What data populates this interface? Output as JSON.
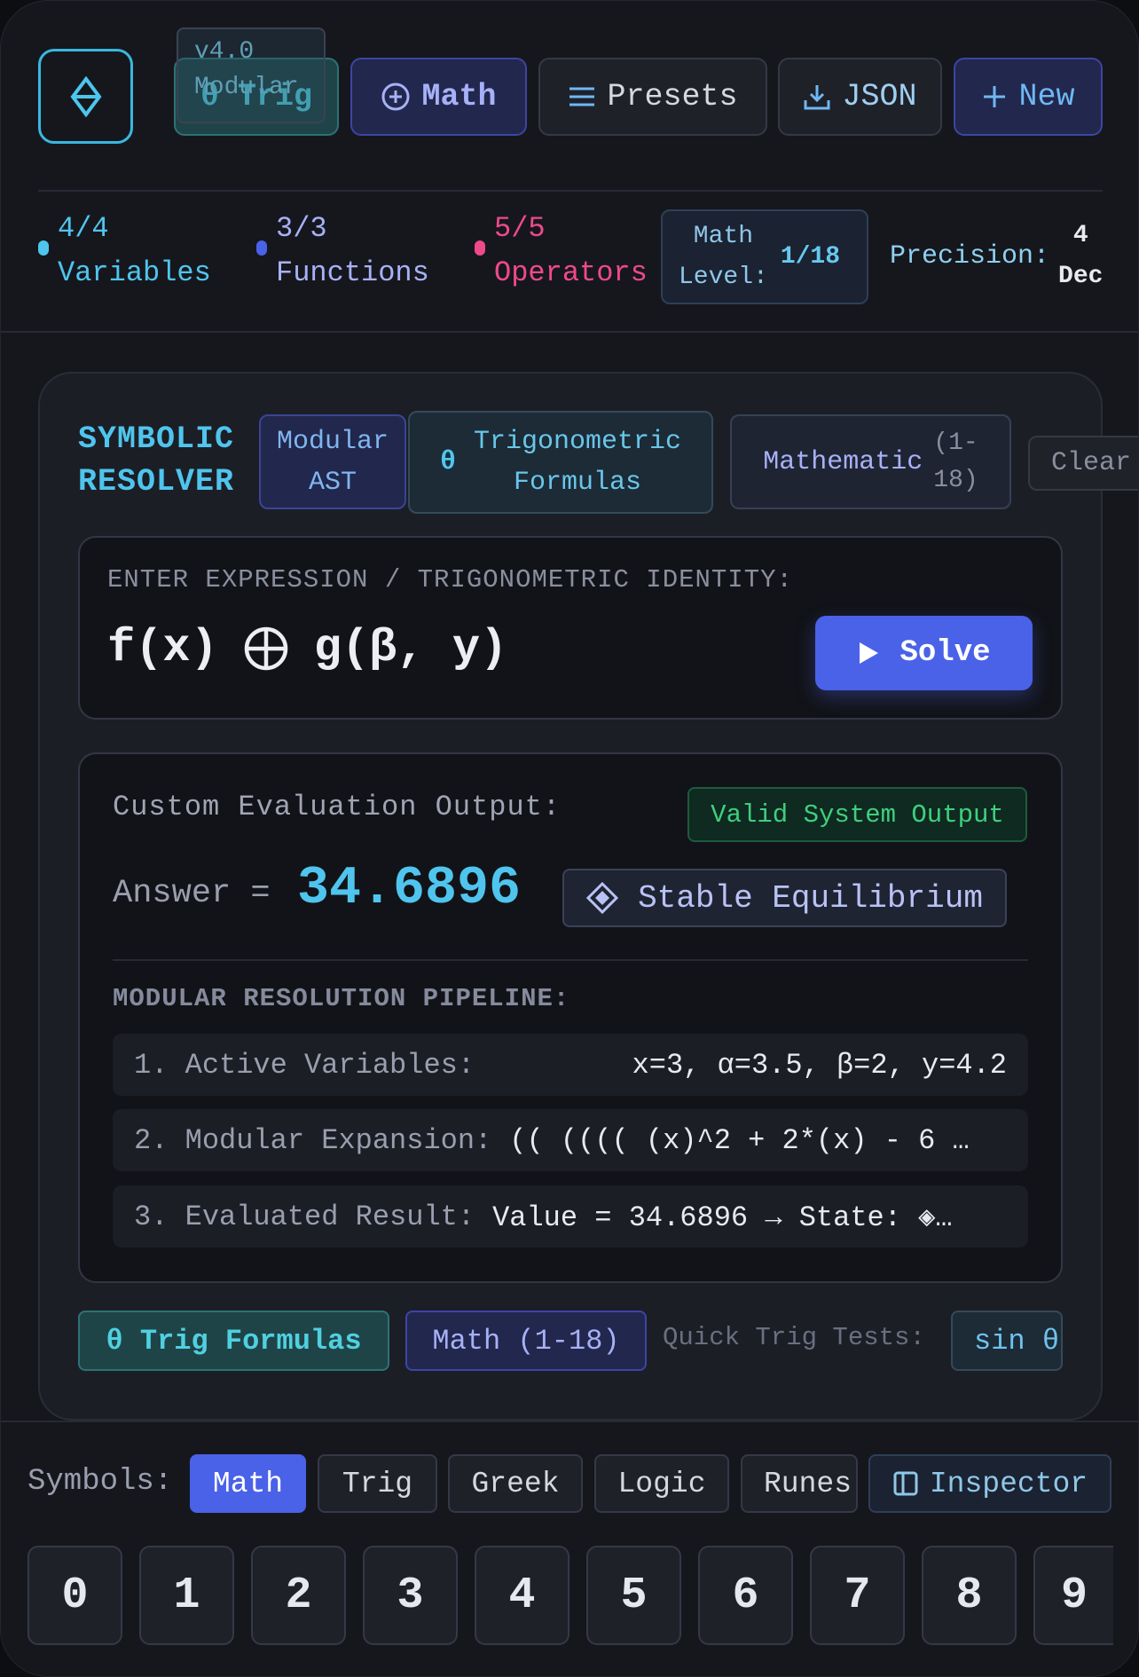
{
  "header": {
    "version": "v4.0",
    "version_sub": "Modular",
    "tabs": [
      {
        "icon": "theta-icon",
        "label": "θ Trig"
      },
      {
        "icon": "plus-circle-icon",
        "label": "Math"
      },
      {
        "icon": "menu-icon",
        "label": "Presets"
      },
      {
        "icon": "download-icon",
        "label": "JSON"
      },
      {
        "icon": "plus-icon",
        "label": "New"
      }
    ]
  },
  "stats": {
    "variables": {
      "count": "4/4",
      "label": "Variables",
      "color": "#4fc5ee"
    },
    "functions": {
      "count": "3/3",
      "label": "Functions",
      "color": "#4a62e8"
    },
    "operators": {
      "count": "5/5",
      "label": "Operators",
      "color": "#ee4a8a"
    },
    "level": {
      "label_line1": "Math",
      "label_line2": "Level:",
      "value": "1/18"
    },
    "precision": {
      "label": "Precision:",
      "value_line1": "4",
      "value_line2": "Dec"
    }
  },
  "resolver": {
    "title_line1": "SYMBOLIC",
    "title_line2": "RESOLVER",
    "chip_ast_line1": "Modular",
    "chip_ast_line2": "AST",
    "chip_trig_symbol": "θ",
    "chip_trig_line1": "Trigonometric",
    "chip_trig_line2": "Formulas",
    "chip_math": "Mathematic",
    "chip_math_range_line1": "(1-",
    "chip_math_range_line2": "18)",
    "chip_clear": "Clear"
  },
  "expression": {
    "label": "ENTER EXPRESSION / TRIGONOMETRIC IDENTITY:",
    "left": "f(x)",
    "right": "g(β, y)",
    "solve_label": "Solve"
  },
  "output": {
    "label": "Custom Evaluation Output:",
    "status": "Valid System Output",
    "answer_label": "Answer =",
    "answer_value": "34.6896",
    "state_label": "Stable Equilibrium",
    "pipeline_title": "MODULAR RESOLUTION PIPELINE:",
    "steps": [
      {
        "key": "1. Active Variables:",
        "value": "x=3, α=3.5, β=2, y=4.2"
      },
      {
        "key": "2. Modular Expansion:",
        "value": "(( (((( (x)^2 + 2*(x) - 6 …"
      },
      {
        "key": "3. Evaluated Result:",
        "value": "Value = 34.6896 → State: ◈…"
      }
    ]
  },
  "quick": {
    "trig_label": "θ Trig Formulas",
    "math_label": "Math (1-18)",
    "tests_label": "Quick Trig Tests:",
    "sin_label": "sin θ"
  },
  "symbols": {
    "label": "Symbols:",
    "tabs": [
      "Math",
      "Trig",
      "Greek",
      "Logic",
      "Runes"
    ],
    "active": "Math",
    "inspector_label": "Inspector",
    "keys": [
      "0",
      "1",
      "2",
      "3",
      "4",
      "5",
      "6",
      "7",
      "8",
      "9"
    ]
  }
}
